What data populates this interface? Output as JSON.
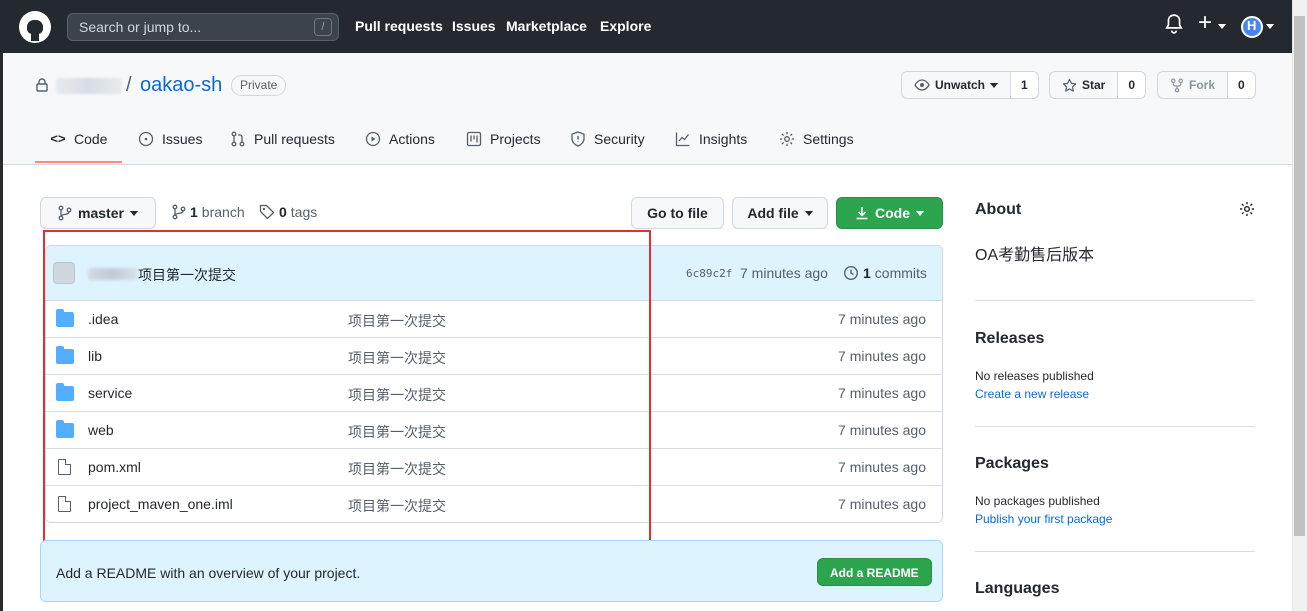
{
  "header": {
    "search_placeholder": "Search or jump to...",
    "search_key": "/",
    "nav": [
      "Pull requests",
      "Issues",
      "Marketplace",
      "Explore"
    ],
    "plus": "+"
  },
  "repo": {
    "name": "oakao-sh",
    "slash": "/",
    "visibility": "Private",
    "watch_label": "Unwatch",
    "watch_count": "1",
    "star_label": "Star",
    "star_count": "0",
    "fork_label": "Fork",
    "fork_count": "0"
  },
  "tabs": [
    {
      "label": "Code",
      "icon": "<>"
    },
    {
      "label": "Issues",
      "icon": "issue-icon"
    },
    {
      "label": "Pull requests",
      "icon": "pull-request-icon"
    },
    {
      "label": "Actions",
      "icon": "play-icon"
    },
    {
      "label": "Projects",
      "icon": "project-icon"
    },
    {
      "label": "Security",
      "icon": "shield-icon"
    },
    {
      "label": "Insights",
      "icon": "graph-icon"
    },
    {
      "label": "Settings",
      "icon": "gear-icon"
    }
  ],
  "branchbar": {
    "branch": "master",
    "branch_count": "1",
    "branch_word": "branch",
    "tag_count": "0",
    "tag_word": "tags",
    "go_to_file": "Go to file",
    "add_file": "Add file",
    "code": "Code"
  },
  "commit": {
    "message": "项目第一次提交",
    "sha": "6c89c2f",
    "time": "7 minutes ago",
    "count": "1",
    "count_word": "commits"
  },
  "files": [
    {
      "name": ".idea",
      "type": "folder",
      "message": "项目第一次提交",
      "time": "7 minutes ago"
    },
    {
      "name": "lib",
      "type": "folder",
      "message": "项目第一次提交",
      "time": "7 minutes ago"
    },
    {
      "name": "service",
      "type": "folder",
      "message": "项目第一次提交",
      "time": "7 minutes ago"
    },
    {
      "name": "web",
      "type": "folder",
      "message": "项目第一次提交",
      "time": "7 minutes ago"
    },
    {
      "name": "pom.xml",
      "type": "file",
      "message": "项目第一次提交",
      "time": "7 minutes ago"
    },
    {
      "name": "project_maven_one.iml",
      "type": "file",
      "message": "项目第一次提交",
      "time": "7 minutes ago"
    }
  ],
  "readme": {
    "text": "Add a README with an overview of your project.",
    "button": "Add a README"
  },
  "sidebar": {
    "about_title": "About",
    "description": "OA考勤售后版本",
    "releases_title": "Releases",
    "releases_text": "No releases published",
    "releases_link": "Create a new release",
    "packages_title": "Packages",
    "packages_text": "No packages published",
    "packages_link": "Publish your first package",
    "languages_title": "Languages"
  },
  "colors": {
    "header_bg": "#24292f",
    "link": "#0969da",
    "green": "#2da44e",
    "annotation": "#e03131"
  }
}
